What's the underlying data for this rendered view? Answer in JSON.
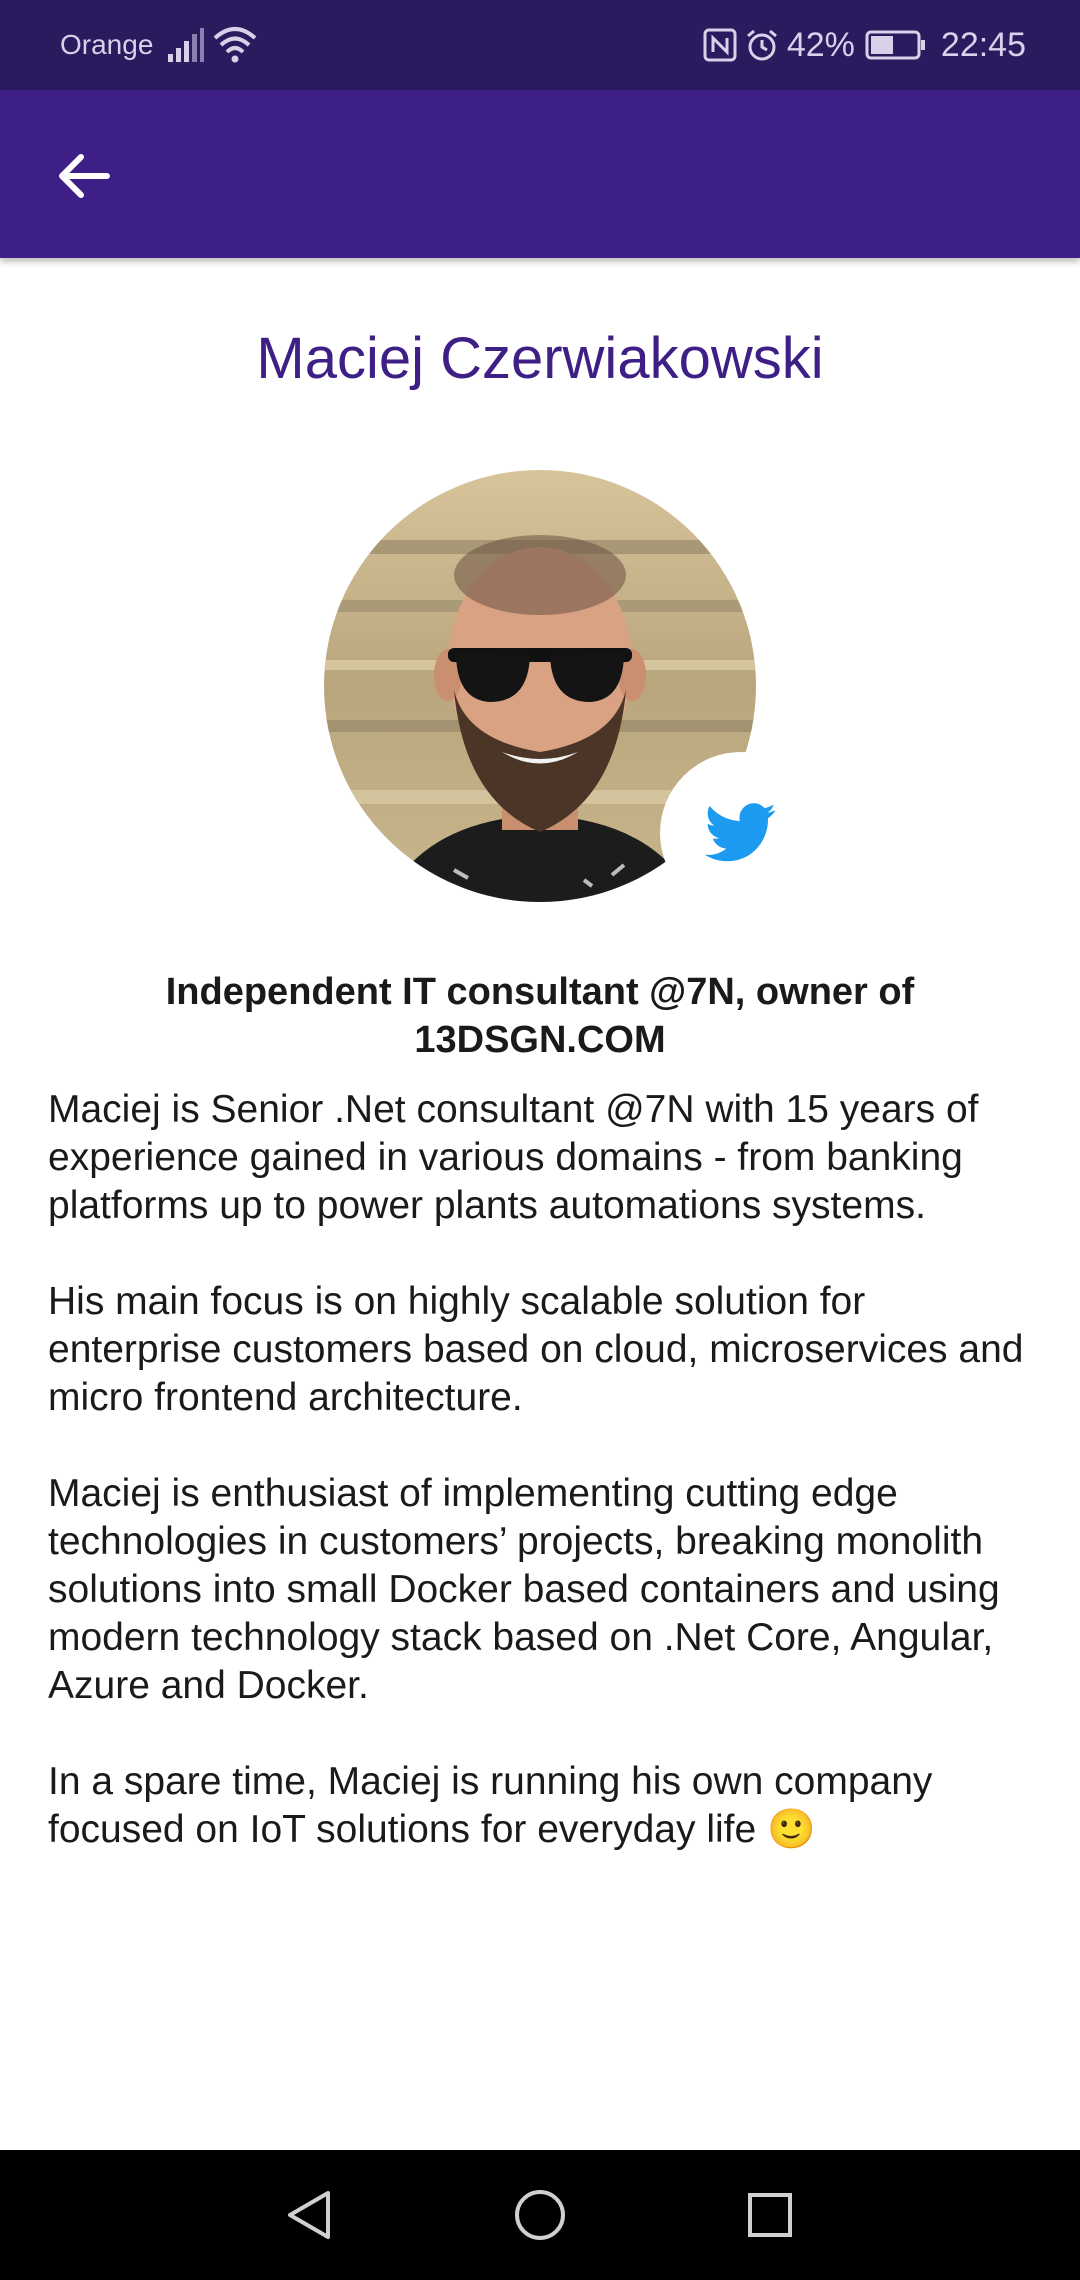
{
  "status_bar": {
    "carrier": "Orange",
    "battery": "42%",
    "time": "22:45",
    "icons": [
      "signal-icon",
      "wifi-icon",
      "nfc-icon",
      "alarm-icon",
      "battery-icon"
    ]
  },
  "app_bar": {
    "back_icon": "arrow-back-icon",
    "color": "#3e1f86"
  },
  "profile": {
    "name": "Maciej Czerwiakowski",
    "headline": "Independent IT consultant @7N, owner of 13DSGN.COM",
    "social_icon": "twitter-icon",
    "bio": [
      "Maciej is Senior .Net consultant @7N with 15 years of experience gained in various domains - from banking platforms up to power plants automations systems.",
      "His main focus is on highly scalable solution for enterprise customers based on cloud, microservices and micro frontend architecture.",
      "Maciej is enthusiast of implementing cutting edge technologies in customers’ projects, breaking monolith solutions into small Docker based containers and using modern technology stack based on .Net Core, Angular, Azure and Docker.",
      "In a spare time, Maciej is running his own company focused on IoT solutions for everyday life 🙂"
    ]
  },
  "nav_bar": {
    "icons": [
      "back-triangle-icon",
      "home-circle-icon",
      "recents-square-icon"
    ]
  },
  "colors": {
    "status_bar": "#2a1a5e",
    "accent": "#3e1f86",
    "twitter": "#1d9bf0"
  }
}
